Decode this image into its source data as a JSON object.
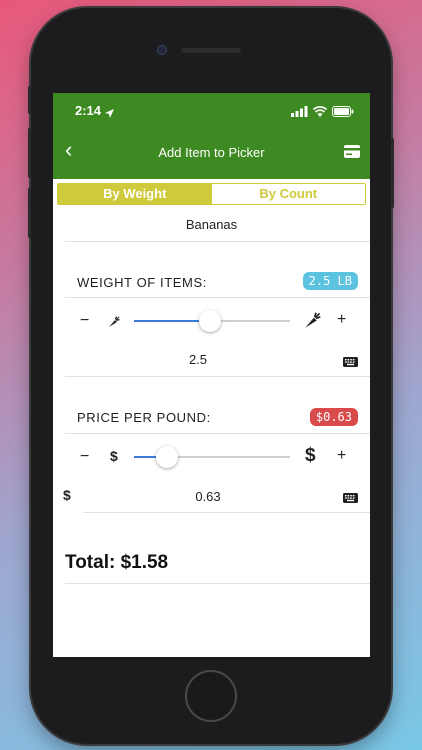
{
  "status": {
    "time": "2:14"
  },
  "nav": {
    "title": "Add Item to Picker"
  },
  "segments": [
    "By Weight",
    "By Count"
  ],
  "item": {
    "name": "Bananas"
  },
  "weight": {
    "label": "WEIGHT OF ITEMS:",
    "badge": "2.5 LB",
    "badge_color": "#5bc2e0",
    "value": "2.5",
    "slider_fraction": 0.49
  },
  "price": {
    "label": "PRICE PER POUND:",
    "badge": "$0.63",
    "badge_color": "#d94b4b",
    "currency_symbol": "$",
    "value": "0.63",
    "slider_fraction": 0.21
  },
  "controls": {
    "minus": "−",
    "plus": "+"
  },
  "total": {
    "text": "Total: $1.58"
  },
  "colors": {
    "nav": "#3e8a22",
    "segment": "#cfc93c",
    "slider": "#3b7bd8"
  }
}
